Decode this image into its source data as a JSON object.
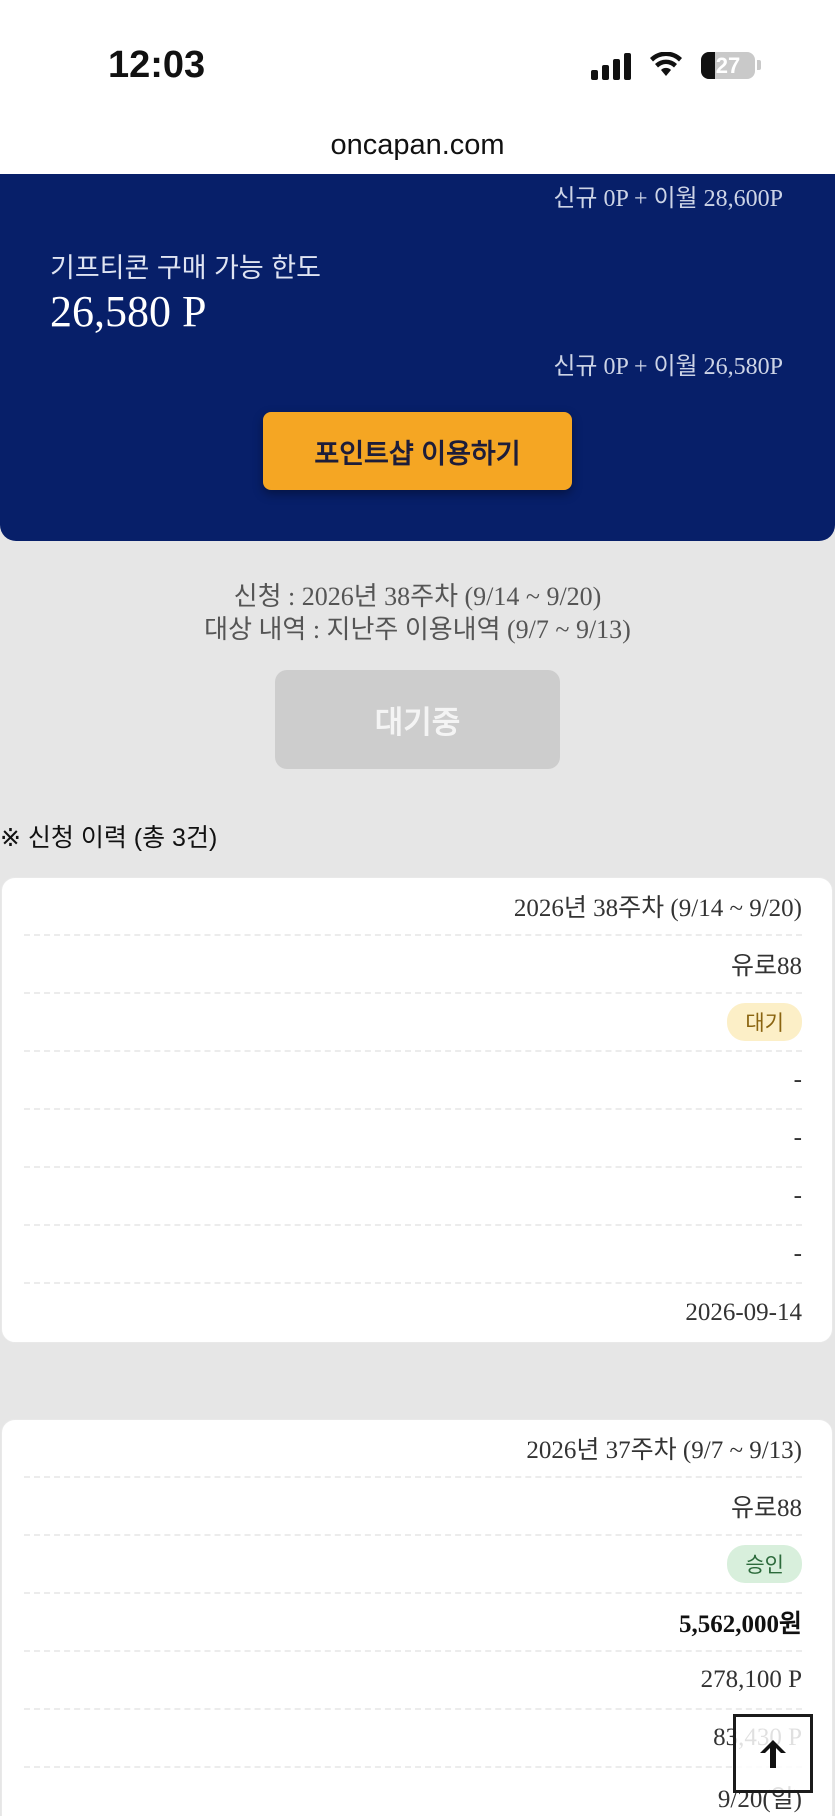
{
  "status_bar": {
    "time": "12:03",
    "battery": "27"
  },
  "url": "oncapan.com",
  "points": {
    "sub_line_1": "신규 0P + 이월 28,600P",
    "limit_label": "기프티콘 구매 가능 한도",
    "limit_value": "26,580 P",
    "sub_line_2": "신규 0P + 이월 26,580P",
    "shop_button": "포인트샵 이용하기"
  },
  "apply": {
    "week": "신청 : 2026년 38주차 (9/14 ~ 9/20)",
    "target": "대상 내역 : 지난주 이용내역 (9/7 ~ 9/13)",
    "button": "대기중"
  },
  "history": {
    "title": "※ 신청 이력 (총 3건)",
    "cards": [
      {
        "week": "2026년 38주차 (9/14 ~ 9/20)",
        "site": "유로88",
        "status": "대기",
        "amount": "-",
        "points": "-",
        "extra": "-",
        "extra2": "-",
        "date": "2026-09-14"
      },
      {
        "week": "2026년 37주차 (9/7 ~ 9/13)",
        "site": "유로88",
        "status": "승인",
        "amount": "5,562,000원",
        "points": "278,100 P",
        "extra": "83,430 P",
        "date": "9/20(일)"
      }
    ]
  },
  "colors": {
    "panel_blue": "#071f69",
    "shop_orange": "#f5a623",
    "badge_wait": "#fcefc7",
    "badge_approved": "#d8efdc"
  },
  "icons": {
    "scroll_top": "arrow-up-icon"
  }
}
